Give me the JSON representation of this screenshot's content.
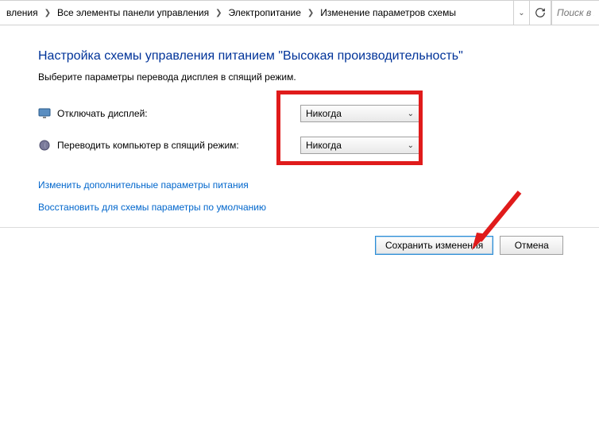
{
  "breadcrumbs": {
    "item0": "вления",
    "item1": "Все элементы панели управления",
    "item2": "Электропитание",
    "item3": "Изменение параметров схемы"
  },
  "search": {
    "placeholder": "Поиск в па"
  },
  "page": {
    "title": "Настройка схемы управления питанием \"Высокая производительность\"",
    "description": "Выберите параметры перевода дисплея в спящий режим."
  },
  "settings": {
    "turn_off_display": {
      "label": "Отключать дисплей:",
      "value": "Никогда"
    },
    "sleep": {
      "label": "Переводить компьютер в спящий режим:",
      "value": "Никогда"
    }
  },
  "links": {
    "advanced": "Изменить дополнительные параметры питания",
    "restore_defaults": "Восстановить для схемы параметры по умолчанию"
  },
  "buttons": {
    "save": "Сохранить изменения",
    "cancel": "Отмена"
  }
}
